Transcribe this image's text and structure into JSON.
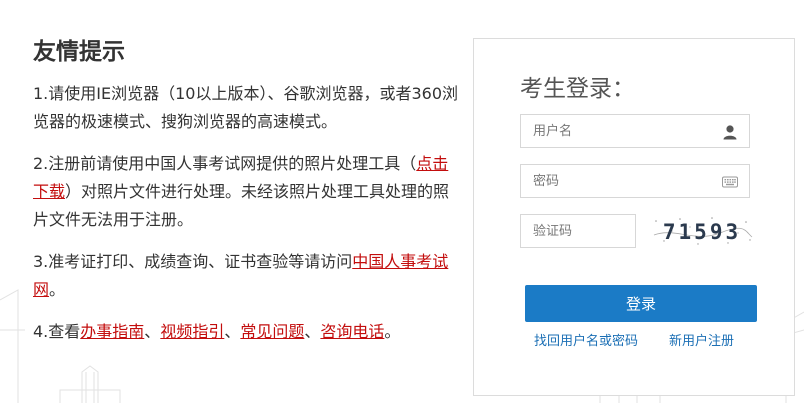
{
  "notice": {
    "title": "友情提示",
    "item1": "1.请使用IE浏览器（10以上版本）、谷歌浏览器，或者360浏览器的极速模式、搜狗浏览器的高速模式。",
    "item2_prefix": "2.注册前请使用中国人事考试网提供的照片处理工具（",
    "item2_link": "点击下载",
    "item2_suffix": "）对照片文件进行处理。未经该照片处理工具处理的照片文件无法用于注册。",
    "item3_prefix": "3.准考证打印、成绩查询、证书查验等请访问",
    "item3_link": "中国人事考试网",
    "item3_suffix": "。",
    "item4_prefix": "4.查看",
    "item4_link1": "办事指南",
    "sep1": "、",
    "item4_link2": "视频指引",
    "sep2": "、",
    "item4_link3": "常见问题",
    "sep3": "、",
    "item4_link4": "咨询电话",
    "item4_suffix": "。"
  },
  "login": {
    "title": "考生登录：",
    "username_placeholder": "用户名",
    "password_placeholder": "密码",
    "captcha_placeholder": "验证码",
    "captcha_text": "71593",
    "submit_label": "登录",
    "recover_link": "找回用户名或密码",
    "register_link": "新用户注册"
  },
  "colors": {
    "link_red": "#c30d0d",
    "button_blue": "#1b7bc6",
    "link_blue": "#1b6fb5"
  }
}
